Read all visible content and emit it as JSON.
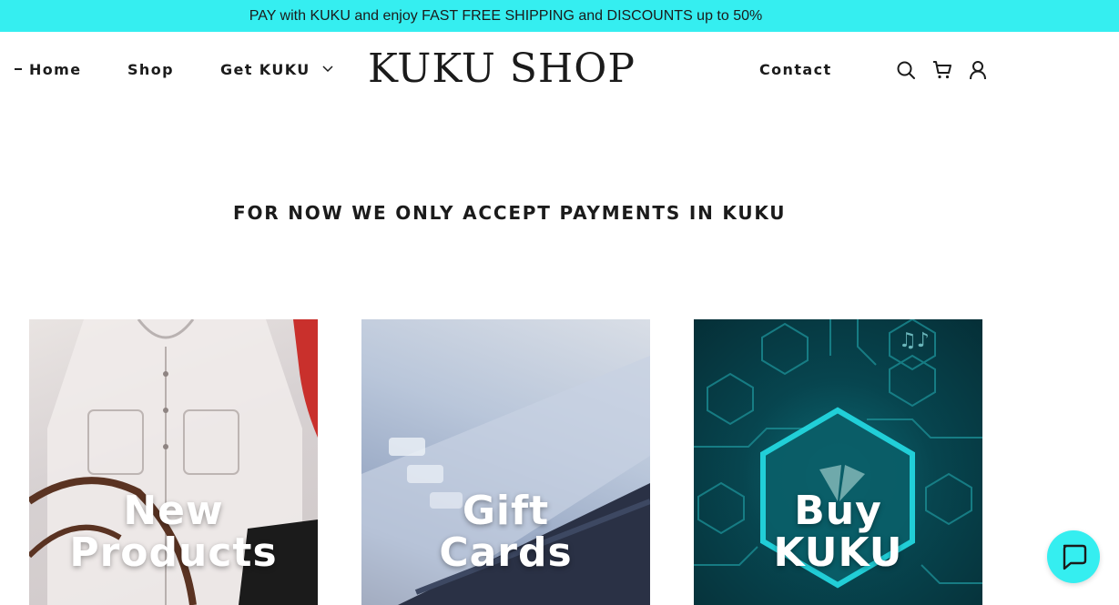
{
  "announcement": "PAY with KUKU and enjoy FAST FREE SHIPPING and DISCOUNTS up to 50%",
  "nav": {
    "home": "Home",
    "shop": "Shop",
    "get_kuku": "Get KUKU",
    "contact": "Contact"
  },
  "logo": "KUKU SHOP",
  "header_icons": [
    "search-icon",
    "cart-icon",
    "user-icon"
  ],
  "section_title": "FOR NOW WE ONLY ACCEPT PAYMENTS IN KUKU",
  "cards": [
    {
      "line1": "New",
      "line2": "Products"
    },
    {
      "line1": "Gift",
      "line2": "Cards"
    },
    {
      "line1": "Buy",
      "line2": "KUKU"
    }
  ],
  "colors": {
    "accent": "#35eef0",
    "text": "#1b1b1b"
  }
}
